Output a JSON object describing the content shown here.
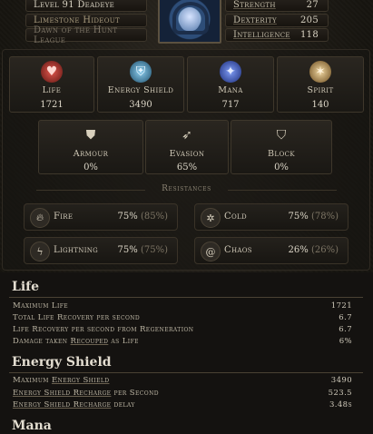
{
  "header": {
    "left": [
      "Level 91 Deadeye",
      "Limestone Hideout",
      "Dawn of the Hunt League"
    ],
    "attributes": [
      {
        "name": "Strength",
        "value": "27"
      },
      {
        "name": "Dexterity",
        "value": "205"
      },
      {
        "name": "Intelligence",
        "value": "118"
      }
    ]
  },
  "primary": [
    {
      "label": "Life",
      "value": "1721",
      "icon": "heart-icon",
      "color": "#b3362e"
    },
    {
      "label": "Energy Shield",
      "value": "3490",
      "icon": "shield-icon",
      "color": "#5fa3c9"
    },
    {
      "label": "Mana",
      "value": "717",
      "icon": "mana-icon",
      "color": "#4f6fd0"
    },
    {
      "label": "Spirit",
      "value": "140",
      "icon": "spirit-icon",
      "color": "#c9a66a"
    }
  ],
  "defence": [
    {
      "label": "Armour",
      "value": "0%",
      "icon": "armour-icon"
    },
    {
      "label": "Evasion",
      "value": "65%",
      "icon": "evasion-icon"
    },
    {
      "label": "Block",
      "value": "0%",
      "icon": "block-icon"
    }
  ],
  "resistances_title": "Resistances",
  "resistances": [
    {
      "name": "Fire",
      "value": "75%",
      "max": "(85%)",
      "icon": "fire-icon"
    },
    {
      "name": "Cold",
      "value": "75%",
      "max": "(78%)",
      "icon": "cold-icon"
    },
    {
      "name": "Lightning",
      "value": "75%",
      "max": "(75%)",
      "icon": "lightning-icon"
    },
    {
      "name": "Chaos",
      "value": "26%",
      "max": "(26%)",
      "icon": "chaos-icon"
    }
  ],
  "sections": {
    "life": {
      "title": "Life",
      "rows": [
        {
          "label": "Maximum Life",
          "value": "1721"
        },
        {
          "label": "Total Life Recovery per second",
          "value": "6.7"
        },
        {
          "label": "Life Recovery per second from Regeneration",
          "value": "6.7"
        },
        {
          "label_pre": "Damage taken ",
          "label_u": "Recouped",
          "label_post": " as Life",
          "value": "6%"
        }
      ]
    },
    "energy_shield": {
      "title": "Energy Shield",
      "rows": [
        {
          "label_pre": "Maximum ",
          "label_u": "Energy Shield",
          "label_post": "",
          "value": "3490"
        },
        {
          "label_pre": "",
          "label_u": "Energy Shield Recharge",
          "label_post": " per Second",
          "value": "523.5"
        },
        {
          "label_pre": "",
          "label_u": "Energy Shield Recharge",
          "label_post": " delay",
          "value": "3.48s"
        }
      ]
    },
    "mana": {
      "title": "Mana"
    }
  }
}
